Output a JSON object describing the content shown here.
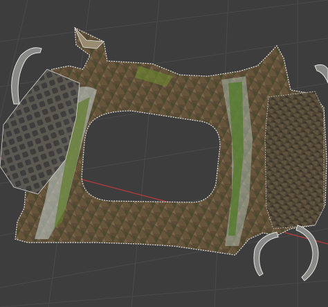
{
  "viewport": {
    "mode": "3d-viewport",
    "background_color": "#3d3d3d",
    "grid_color": "#4a4a4a",
    "x_axis_color": "#c0393b"
  },
  "mesh": {
    "object": "photogrammetry-mesh",
    "selected": true,
    "outline_color": "#e6e6e6",
    "texture_palette": [
      "#5a4a36",
      "#6b5a3e",
      "#3f5a2a",
      "#7a8a3a",
      "#c9d6d6",
      "#2f2a22"
    ]
  }
}
